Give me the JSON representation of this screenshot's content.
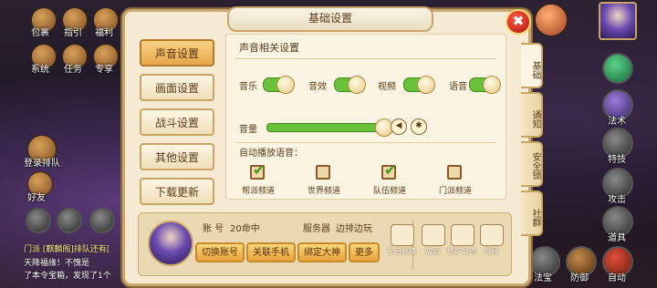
{
  "hud_left": [
    {
      "label": "包裹",
      "icon": "bag-icon"
    },
    {
      "label": "指引",
      "icon": "guide-icon"
    },
    {
      "label": "福利",
      "icon": "gift-icon"
    },
    {
      "label": "系统",
      "icon": "gear-icon"
    },
    {
      "label": "任务",
      "icon": "task-icon"
    },
    {
      "label": "专享",
      "icon": "vip-icon"
    }
  ],
  "left_side": {
    "team": "登录排队",
    "friends": "好友"
  },
  "chat": {
    "line1": "门派 [麒麟阁]排队还有[",
    "line2": "天降福缘！不愧是",
    "line3": "了本令宝箱，发现了1个"
  },
  "right_side": [
    {
      "label": "法术"
    },
    {
      "label": "特技"
    },
    {
      "label": "攻击"
    },
    {
      "label": "道具"
    },
    {
      "label": "自动"
    }
  ],
  "bottom_right": {
    "defend": "防御",
    "magic": "法宝"
  },
  "panel": {
    "title": "基础设置",
    "close": "✖",
    "menu": [
      "声音设置",
      "画面设置",
      "战斗设置",
      "其他设置",
      "下载更新"
    ],
    "right_tabs": [
      "基础",
      "通知",
      "安全锁",
      "社群"
    ],
    "sound": {
      "section_title": "声音相关设置",
      "music": "音乐",
      "effects": "音效",
      "video": "视频",
      "voice": "语音",
      "volume": "音量",
      "volume_level": 0.95,
      "auto_voice": "自动播放语音：",
      "channels": [
        {
          "label": "帮派频道",
          "checked": true
        },
        {
          "label": "世界频道",
          "checked": false
        },
        {
          "label": "队伍频道",
          "checked": true
        },
        {
          "label": "门派频道",
          "checked": false
        }
      ]
    },
    "account": {
      "account_label": "账 号",
      "account_value": "20命中",
      "server_label": "服务器",
      "server_value": "边排边玩",
      "buttons": [
        "切换账号",
        "关联手机",
        "绑定大神",
        "更多"
      ],
      "extras": [
        "礼包兑换",
        "防沉",
        "维护公告",
        "扫码"
      ]
    }
  }
}
